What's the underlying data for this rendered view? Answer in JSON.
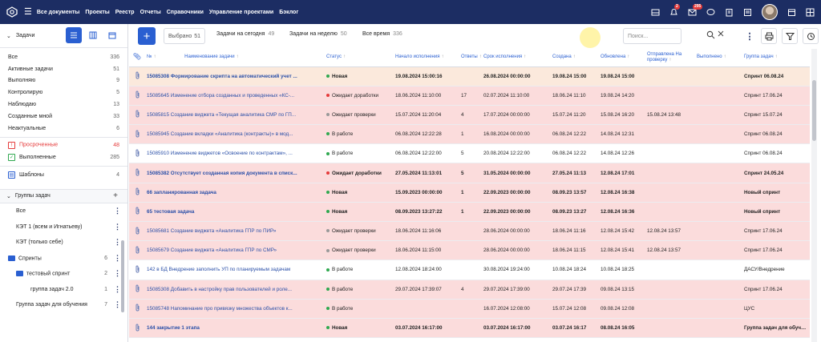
{
  "colors": {
    "topbar": "#1c2d63",
    "accent": "#2a5fd1",
    "overdue": "#e53b3b",
    "done": "#2fa84f",
    "row_red": "#fbdcdc",
    "row_peach": "#fbe9dc"
  },
  "topbar": {
    "nav": [
      "Все документы",
      "Проекты",
      "Реестр",
      "Отчеты",
      "Справочники",
      "Управление проектами",
      "Бэклог"
    ],
    "notif_badge": "2",
    "mail_badge": "295"
  },
  "sidebar": {
    "title": "Задачи",
    "items": [
      {
        "label": "Все",
        "count": "336"
      },
      {
        "label": "Активные задачи",
        "count": "51"
      },
      {
        "label": "Выполняю",
        "count": "9"
      },
      {
        "label": "Контролирую",
        "count": "5"
      },
      {
        "label": "Наблюдаю",
        "count": "13"
      },
      {
        "label": "Созданные мной",
        "count": "33"
      },
      {
        "label": "Неактуальные",
        "count": "6"
      }
    ],
    "overdue": {
      "label": "Просроченные",
      "count": "48"
    },
    "completed": {
      "label": "Выполненные",
      "count": "285"
    },
    "templates": {
      "label": "Шаблоны",
      "count": "4"
    },
    "groups_title": "Группы задач",
    "groups": [
      {
        "label": "Все",
        "count": ""
      },
      {
        "label": "КЭТ 1 (всем и Игнатьеву)",
        "count": ""
      },
      {
        "label": "КЭТ (только себе)",
        "count": ""
      },
      {
        "label": "Спринты",
        "count": "6"
      },
      {
        "label": "тестовый спринт",
        "count": "2"
      },
      {
        "label": "группа задач 2.0",
        "count": "1"
      },
      {
        "label": "Группа задач для обучения",
        "count": "7"
      }
    ]
  },
  "toolbar": {
    "selected_label": "Выбрано",
    "selected_count": "51",
    "filters": [
      {
        "label": "Задачи на сегодня",
        "count": "49"
      },
      {
        "label": "Задачи на неделю",
        "count": "50"
      },
      {
        "label": "Все время",
        "count": "336"
      }
    ],
    "search_placeholder": "Поиск..."
  },
  "table": {
    "columns": [
      "№",
      "Наименование задачи",
      "Статус",
      "Начало исполнения",
      "Ответы",
      "Срок исполнения",
      "Создана",
      "Обновлена",
      "Отправлена На проверку",
      "Выполнено",
      "Группа задач"
    ],
    "rows": [
      {
        "bg": "peach",
        "bold": true,
        "name": "15085308 Формирование скрипта на автоматический учет ...",
        "status": "Новая",
        "dot": "#2fa84f",
        "start": "19.08.2024 15:00:16",
        "replies": "",
        "deadline": "26.08.2024 00:00:00",
        "created": "19.08.24 15:00",
        "updated": "19.08.24 15:00",
        "sent": "",
        "done": "",
        "group": "Спринт 06.08.24"
      },
      {
        "bg": "red",
        "bold": false,
        "name": "15085645 Изменение отбора созданных и проведенных «КС-...",
        "status": "Ожидает доработки",
        "dot": "#e53b3b",
        "start": "18.06.2024 11:10:00",
        "replies": "17",
        "deadline": "02.07.2024 11:10:00",
        "created": "18.06.24 11:10",
        "updated": "19.08.24 14:20",
        "sent": "",
        "done": "",
        "group": "Спринт 17.06.24"
      },
      {
        "bg": "red",
        "bold": false,
        "name": "15085815 Создание виджета «Текущая аналитика СМР по ГП...",
        "status": "Ожидает проверки",
        "dot": "#999999",
        "start": "15.07.2024 11:20:04",
        "replies": "4",
        "deadline": "17.07.2024 00:00:00",
        "created": "15.07.24 11:20",
        "updated": "15.08.24 16:20",
        "sent": "15.08.24 13:48",
        "done": "",
        "group": "Спринт 15.07.24"
      },
      {
        "bg": "red",
        "bold": false,
        "name": "15085945 Создание вкладки «Аналитика (контракты)» в мод...",
        "status": "В работе",
        "dot": "#2fa84f",
        "start": "06.08.2024 12:22:28",
        "replies": "1",
        "deadline": "16.08.2024 00:00:00",
        "created": "06.08.24 12:22",
        "updated": "14.08.24 12:31",
        "sent": "",
        "done": "",
        "group": "Спринт 06.08.24"
      },
      {
        "bg": "white",
        "bold": false,
        "name": "15085910 Изменение виджетов «Освоение по контрактам», ...",
        "status": "В работе",
        "dot": "#2fa84f",
        "start": "06.08.2024 12:22:00",
        "replies": "5",
        "deadline": "20.08.2024 12:22:00",
        "created": "06.08.24 12:22",
        "updated": "14.08.24 12:26",
        "sent": "",
        "done": "",
        "group": "Спринт 06.08.24"
      },
      {
        "bg": "red",
        "bold": true,
        "name": "15085382 Отсутствует созданная копия документа в списк...",
        "status": "Ожидает доработки",
        "dot": "#e53b3b",
        "start": "27.05.2024 11:13:01",
        "replies": "5",
        "deadline": "31.05.2024 00:00:00",
        "created": "27.05.24 11:13",
        "updated": "12.08.24 17:01",
        "sent": "",
        "done": "",
        "group": "Спринт 24.05.24"
      },
      {
        "bg": "red",
        "bold": true,
        "name": "66 запланированная задача",
        "status": "Новая",
        "dot": "#2fa84f",
        "start": "15.09.2023 00:00:00",
        "replies": "1",
        "deadline": "22.09.2023 00:00:00",
        "created": "08.09.23 13:57",
        "updated": "12.08.24 16:38",
        "sent": "",
        "done": "",
        "group": "Новый спринт"
      },
      {
        "bg": "red",
        "bold": true,
        "name": "65 тестовая задача",
        "status": "Новая",
        "dot": "#2fa84f",
        "start": "08.09.2023 13:27:22",
        "replies": "1",
        "deadline": "22.09.2023 00:00:00",
        "created": "08.09.23 13:27",
        "updated": "12.08.24 16:36",
        "sent": "",
        "done": "",
        "group": "Новый спринт"
      },
      {
        "bg": "red",
        "bold": false,
        "name": "15085681 Создание виджета «Аналитика ГПР по ПИР»",
        "status": "Ожидает проверки",
        "dot": "#999999",
        "start": "18.06.2024 11:16:06",
        "replies": "",
        "deadline": "28.06.2024 00:00:00",
        "created": "18.06.24 11:16",
        "updated": "12.08.24 15:42",
        "sent": "12.08.24 13:57",
        "done": "",
        "group": "Спринт 17.06.24"
      },
      {
        "bg": "red",
        "bold": false,
        "name": "15085679 Создание виджета «Аналитика ГПР по СМР»",
        "status": "Ожидает проверки",
        "dot": "#999999",
        "start": "18.06.2024 11:15:00",
        "replies": "",
        "deadline": "28.06.2024 00:00:00",
        "created": "18.06.24 11:15",
        "updated": "12.08.24 15:41",
        "sent": "12.08.24 13:57",
        "done": "",
        "group": "Спринт 17.06.24"
      },
      {
        "bg": "white",
        "bold": false,
        "name": "142 в БД Внедрение заполнить УП по планируемым задачам",
        "status": "В работе",
        "dot": "#2fa84f",
        "start": "12.08.2024 18:24:00",
        "replies": "",
        "deadline": "30.08.2024 19:24:00",
        "created": "10.08.24 18:24",
        "updated": "10.08.24 18:25",
        "sent": "",
        "done": "",
        "group": "ДАСУ/Внедрение"
      },
      {
        "bg": "red",
        "bold": false,
        "name": "15085308 Добавить в настройку прав пользователей и роле...",
        "status": "В работе",
        "dot": "#2fa84f",
        "start": "29.07.2024 17:39:07",
        "replies": "4",
        "deadline": "29.07.2024 17:39:00",
        "created": "29.07.24 17:39",
        "updated": "09.08.24 13:15",
        "sent": "",
        "done": "",
        "group": "Спринт 17.06.24"
      },
      {
        "bg": "red",
        "bold": false,
        "name": "15085748 Напоминание про привязку множества объектов к...",
        "status": "В работе",
        "dot": "#2fa84f",
        "start": "",
        "replies": "",
        "deadline": "16.07.2024 12:08:00",
        "created": "15.07.24 12:08",
        "updated": "09.08.24 12:08",
        "sent": "",
        "done": "",
        "group": "ЦУС"
      },
      {
        "bg": "red",
        "bold": true,
        "name": "144 закрытие 1 этапа",
        "status": "Новая",
        "dot": "#2fa84f",
        "start": "03.07.2024 16:17:00",
        "replies": "",
        "deadline": "03.07.2024 16:17:00",
        "created": "03.07.24 16:17",
        "updated": "08.08.24 16:05",
        "sent": "",
        "done": "",
        "group": "Группа задач для обучения"
      }
    ]
  }
}
